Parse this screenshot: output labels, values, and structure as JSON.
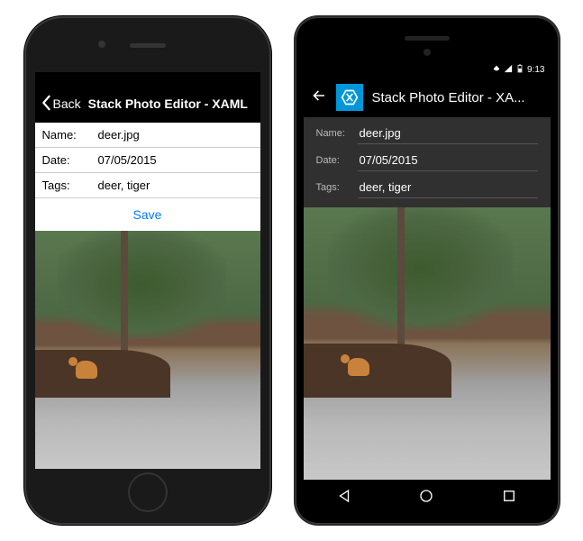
{
  "ios": {
    "nav": {
      "back_label": "Back",
      "title": "Stack Photo Editor - XAML"
    },
    "form": {
      "name_label": "Name:",
      "name_value": "deer.jpg",
      "date_label": "Date:",
      "date_value": "07/05/2015",
      "tags_label": "Tags:",
      "tags_value": "deer, tiger",
      "save_label": "Save"
    }
  },
  "android": {
    "status": {
      "time": "9:13"
    },
    "actionbar": {
      "title": "Stack Photo Editor - XA..."
    },
    "form": {
      "name_label": "Name:",
      "name_value": "deer.jpg",
      "date_label": "Date:",
      "date_value": "07/05/2015",
      "tags_label": "Tags:",
      "tags_value": "deer, tiger"
    }
  }
}
